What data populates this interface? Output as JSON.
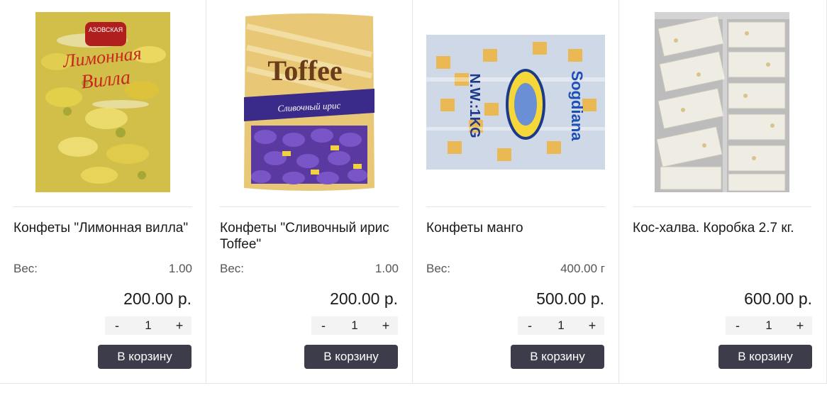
{
  "products": [
    {
      "title": "Конфеты \"Лимонная вилла\"",
      "weight_label": "Вес:",
      "weight_value": "1.00",
      "price": "200.00 р.",
      "qty": "1",
      "minus": "-",
      "plus": "+",
      "cart_label": "В корзину",
      "image": {
        "name": "lemon-villa-candy-image",
        "brand_text": "АЗОВСКАЯ",
        "script_text": "Лимонная Вилла"
      }
    },
    {
      "title": "Конфеты \"Сливочный ирис Toffee\"",
      "weight_label": "Вес:",
      "weight_value": "1.00",
      "price": "200.00 р.",
      "qty": "1",
      "minus": "-",
      "plus": "+",
      "cart_label": "В корзину",
      "image": {
        "name": "toffee-candy-image",
        "brand_text": "Toffee",
        "script_text": "Сливочный ирис"
      }
    },
    {
      "title": "Конфеты манго",
      "weight_label": "Вес:",
      "weight_value": "400.00 г",
      "price": "500.00 р.",
      "qty": "1",
      "minus": "-",
      "plus": "+",
      "cart_label": "В корзину",
      "image": {
        "name": "mango-candy-image",
        "brand_text": "Sogdiana",
        "script_text": "N.W.:1KG"
      }
    },
    {
      "title": "Кос-халва. Коробка 2.7 кг.",
      "weight_label": "",
      "weight_value": "",
      "price": "600.00 р.",
      "qty": "1",
      "minus": "-",
      "plus": "+",
      "cart_label": "В корзину",
      "image": {
        "name": "kos-halva-image",
        "brand_text": "",
        "script_text": ""
      }
    }
  ],
  "colors": {
    "button_bg": "#3c3c4a",
    "stepper_bg": "#f3f3f3",
    "divider": "#e4e4e4"
  }
}
